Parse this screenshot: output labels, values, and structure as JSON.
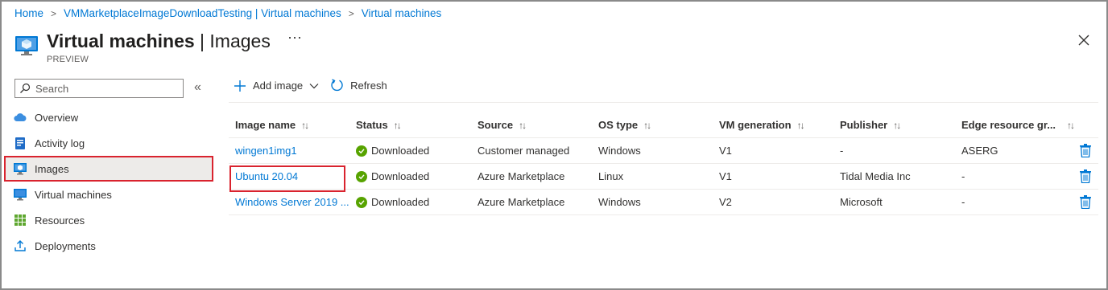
{
  "breadcrumb": [
    "Home",
    "VMMarketplaceImageDownloadTesting | Virtual machines",
    "Virtual machines"
  ],
  "header": {
    "title_main": "Virtual machines",
    "title_sep": " | ",
    "title_sub": "Images",
    "subtitle": "PREVIEW",
    "more_label": "···"
  },
  "sidebar": {
    "search_placeholder": "Search",
    "collapse_label": "«",
    "items": [
      {
        "label": "Overview",
        "icon": "cloud-icon"
      },
      {
        "label": "Activity log",
        "icon": "activity-log-icon"
      },
      {
        "label": "Images",
        "icon": "image-icon",
        "selected": true
      },
      {
        "label": "Virtual machines",
        "icon": "monitor-icon"
      },
      {
        "label": "Resources",
        "icon": "grid-icon"
      },
      {
        "label": "Deployments",
        "icon": "upload-icon"
      }
    ]
  },
  "toolbar": {
    "add_label": "Add image",
    "refresh_label": "Refresh"
  },
  "table": {
    "columns": [
      "Image name",
      "Status",
      "Source",
      "OS type",
      "VM generation",
      "Publisher",
      "Edge resource gr..."
    ],
    "rows": [
      {
        "name": "wingen1img1",
        "status": "Downloaded",
        "source": "Customer managed",
        "os": "Windows",
        "gen": "V1",
        "publisher": "-",
        "edge": "ASERG"
      },
      {
        "name": "Ubuntu 20.04",
        "status": "Downloaded",
        "source": "Azure Marketplace",
        "os": "Linux",
        "gen": "V1",
        "publisher": "Tidal Media Inc",
        "edge": "-"
      },
      {
        "name": "Windows Server 2019 ...",
        "status": "Downloaded",
        "source": "Azure Marketplace",
        "os": "Windows",
        "gen": "V2",
        "publisher": "Microsoft",
        "edge": "-"
      }
    ]
  },
  "colors": {
    "accent": "#0078d4",
    "success": "#57a300",
    "highlight": "#d9232e"
  }
}
